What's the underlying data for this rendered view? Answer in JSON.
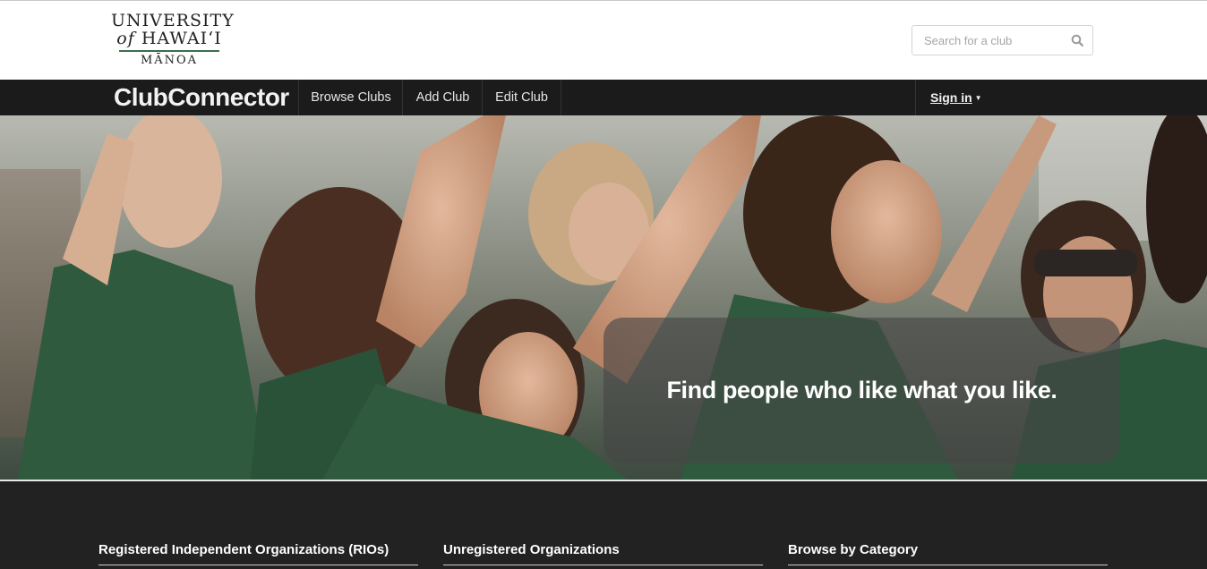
{
  "header": {
    "logo": {
      "line1": "UNIVERSITY",
      "line2_of": "of",
      "line2_rest": "HAWAI‘I",
      "line3": "MĀNOA"
    },
    "search": {
      "placeholder": "Search for a club",
      "icon": "search-icon"
    }
  },
  "navbar": {
    "brand": "ClubConnector",
    "items": [
      "Browse Clubs",
      "Add Club",
      "Edit Club"
    ],
    "signin": {
      "label": "Sign in",
      "caret": "▼"
    }
  },
  "hero": {
    "tagline": "Find people who like what you like."
  },
  "footer": {
    "columns": [
      "Registered Independent Organizations (RIOs)",
      "Unregistered Organizations",
      "Browse by Category"
    ]
  },
  "colors": {
    "navbar_bg": "#1b1b1b",
    "footer_bg": "#222222",
    "logo_green": "#3b6e4f",
    "shirt_green": "#2f5a3e"
  }
}
